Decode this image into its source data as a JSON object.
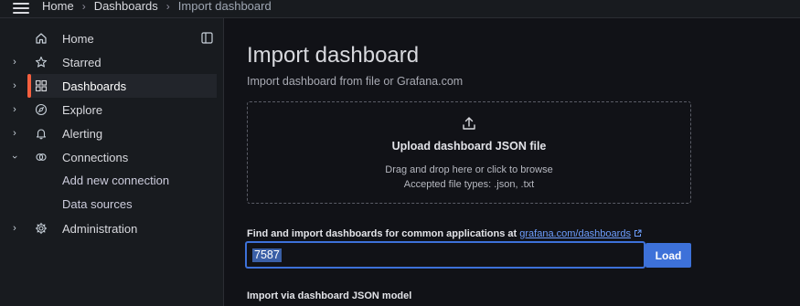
{
  "topbar": {
    "breadcrumbs": [
      "Home",
      "Dashboards",
      "Import dashboard"
    ]
  },
  "sidebar": {
    "items": [
      {
        "label": "Home",
        "icon": "home-icon"
      },
      {
        "label": "Starred",
        "icon": "star-icon"
      },
      {
        "label": "Dashboards",
        "icon": "grid-icon",
        "active": true
      },
      {
        "label": "Explore",
        "icon": "compass-icon"
      },
      {
        "label": "Alerting",
        "icon": "bell-icon"
      },
      {
        "label": "Connections",
        "icon": "connections-icon",
        "expanded": true
      },
      {
        "label": "Add new connection"
      },
      {
        "label": "Data sources"
      },
      {
        "label": "Administration",
        "icon": "cog-icon"
      }
    ]
  },
  "main": {
    "title": "Import dashboard",
    "subtitle": "Import dashboard from file or Grafana.com",
    "upload": {
      "title": "Upload dashboard JSON file",
      "line1": "Drag and drop here or click to browse",
      "line2": "Accepted file types: .json, .txt"
    },
    "find": {
      "text": "Find and import dashboards for common applications at ",
      "link": "grafana.com/dashboards"
    },
    "id_input_value": "7587",
    "load_label": "Load",
    "json_model_label": "Import via dashboard JSON model"
  },
  "colors": {
    "accent": "#3d71d9",
    "active_indicator": "#f55f3e",
    "background": "#111217",
    "sidebar": "#181b1f"
  }
}
